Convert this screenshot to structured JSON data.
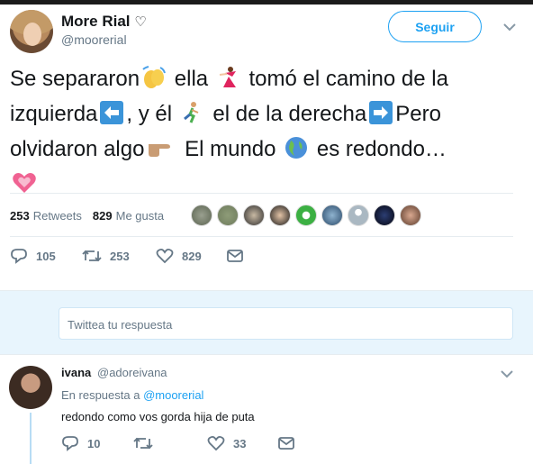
{
  "tweet": {
    "author_name": "More Rial",
    "author_badge_glyph": "♡",
    "author_handle": "@moorerial",
    "follow_label": "Seguir",
    "text_parts": {
      "p1": "Se separaron",
      "p2": " ella ",
      "p3": " tomó el camino de la izquierda",
      "p4": ", y él ",
      "p5": " el de la derecha",
      "p6": "Pero olvidaron algo",
      "p7": " El mundo ",
      "p8": " es redondo…"
    },
    "emojis": [
      "waving-hands-icon",
      "dancer-icon",
      "left-arrow-icon",
      "runner-icon",
      "right-arrow-icon",
      "pointing-hand-icon",
      "globe-icon",
      "heart-icon"
    ],
    "retweets_count": "253",
    "retweets_label": "Retweets",
    "likes_count": "829",
    "likes_label": "Me gusta",
    "actions": {
      "reply_count": "105",
      "retweet_count": "253",
      "like_count": "829"
    }
  },
  "reply_box": {
    "placeholder": "Twittea tu respuesta"
  },
  "reply": {
    "author_name": "ivana",
    "author_handle": "@adoreivana",
    "in_reply_prefix": "En respuesta a ",
    "in_reply_handle": "@moorerial",
    "text": "redondo como vos gorda hija de puta",
    "actions": {
      "reply_count": "10",
      "like_count": "33"
    }
  },
  "colors": {
    "accent": "#1da1f2",
    "muted": "#657786",
    "text": "#14171a",
    "reply_bg": "#e8f5fd"
  }
}
